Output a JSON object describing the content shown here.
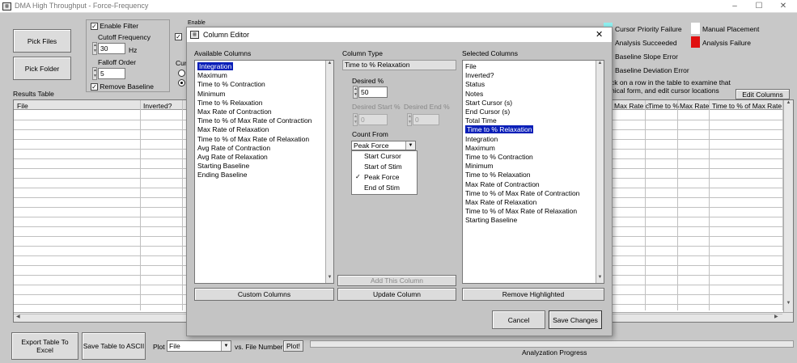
{
  "window": {
    "title": "DMA High Throughput - Force-Frequency",
    "icon": "app-icon"
  },
  "main": {
    "pick_files": "Pick Files",
    "pick_folder": "Pick Folder",
    "enable_filter": "Enable Filter",
    "cutoff_label": "Cutoff Frequency",
    "cutoff_value": "30",
    "cutoff_unit": "Hz",
    "falloff_label": "Falloff Order",
    "falloff_value": "5",
    "remove_baseline": "Remove Baseline",
    "enable_label": "Enable",
    "cur_label": "Cur",
    "results_table": "Results Table",
    "table_headers_left": [
      "File",
      "Inverted?"
    ],
    "table_headers_right": [
      "Max Rate c",
      "Time to %",
      "Max Rate",
      "Time to % of Max Rate of"
    ],
    "instructions_line1": "ck on a row in the table to examine that",
    "instructions_line2": "hical form, and edit cursor locations",
    "edit_columns": "Edit Columns",
    "export_excel": "Export Table To Excel",
    "save_ascii": "Save Table to ASCII",
    "plot_label": "Plot",
    "plot_value": "File",
    "vs_label": "vs. File Number",
    "plot_button": "Plot!",
    "progress_label": "Analyzation Progress"
  },
  "legend": [
    {
      "label": "Cursor Priority Failure",
      "color": "#8ff0f0"
    },
    {
      "label": "Manual Placement",
      "color": "#ffffff"
    },
    {
      "label": "Analysis Succeeded",
      "color": "#2fb52f"
    },
    {
      "label": "Analysis Failure",
      "color": "#e01010"
    },
    {
      "label": "Baseline Slope Error",
      "color": "#f5e000"
    },
    {
      "label": "Baseline Deviation Error",
      "color": "#ff8a00"
    }
  ],
  "dialog": {
    "title": "Column Editor",
    "available_label": "Available Columns",
    "available": [
      "Integration",
      "Maximum",
      "Time to % Contraction",
      "Minimum",
      "Time to % Relaxation",
      "Max Rate of Contraction",
      "Time to % of Max Rate of Contraction",
      "Max Rate of Relaxation",
      "Time to % of Max Rate of Relaxation",
      "Avg Rate of Contraction",
      "Avg Rate of Relaxation",
      "Starting Baseline",
      "Ending Baseline"
    ],
    "column_type_label": "Column Type",
    "column_type_value": "Time to % Relaxation",
    "desired_pct_label": "Desired %",
    "desired_pct_value": "50",
    "desired_start_label": "Desired Start %",
    "desired_start_value": "0",
    "desired_end_label": "Desired End %",
    "desired_end_value": "0",
    "count_from_label": "Count From",
    "count_from_value": "Peak Force",
    "count_from_options": [
      "Start Cursor",
      "Start of Stim",
      "Peak Force",
      "End of Stim"
    ],
    "count_from_checked": "✓",
    "selected_label": "Selected Columns",
    "selected": [
      "File",
      "Inverted?",
      "Status",
      "Notes",
      "Start Cursor (s)",
      "End Cursor (s)",
      "Total Time",
      "Time to % Relaxation",
      "Integration",
      "Maximum",
      "Time to % Contraction",
      "Minimum",
      "Time to % Relaxation",
      "Max Rate of Contraction",
      "Time to % of Max Rate of Contraction",
      "Max Rate of Relaxation",
      "Time to % of Max Rate of Relaxation",
      "Starting Baseline"
    ],
    "custom_columns": "Custom Columns",
    "add_column": "Add This Column",
    "update_column": "Update Column",
    "remove_highlighted": "Remove Highlighted",
    "cancel": "Cancel",
    "save_changes": "Save Changes",
    "close": "✕"
  }
}
